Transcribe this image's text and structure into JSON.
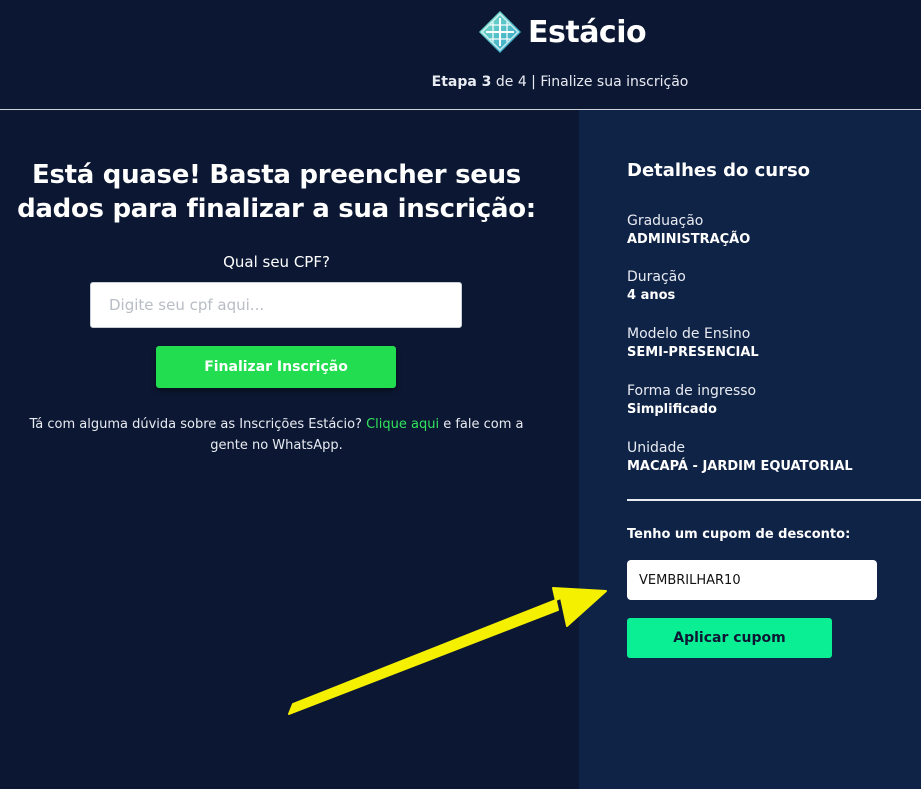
{
  "header": {
    "brand": "Estácio",
    "step_bold": "Etapa 3",
    "step_rest": " de 4 | Finalize sua inscrição"
  },
  "form": {
    "headline": "Está quase! Basta preencher seus dados para finalizar a sua inscrição:",
    "cpf_label": "Qual seu CPF?",
    "cpf_placeholder": "Digite seu cpf aqui...",
    "cpf_value": "",
    "submit_label": "Finalizar Inscrição",
    "help_before": "Tá com alguma dúvida sobre as Inscrições Estácio? ",
    "help_link": "Clique aqui",
    "help_after": " e fale com a gente no WhatsApp."
  },
  "course": {
    "title": "Detalhes do curso",
    "details": [
      {
        "label": "Graduação",
        "value": "ADMINISTRAÇÃO"
      },
      {
        "label": "Duração",
        "value": "4 anos"
      },
      {
        "label": "Modelo de Ensino",
        "value": "SEMI-PRESENCIAL"
      },
      {
        "label": "Forma de ingresso",
        "value": "Simplificado"
      },
      {
        "label": "Unidade",
        "value": "MACAPÁ - JARDIM EQUATORIAL"
      }
    ],
    "coupon_label": "Tenho um cupom de desconto:",
    "coupon_value": "VEMBRILHAR10",
    "coupon_button": "Aplicar cupom"
  },
  "colors": {
    "background": "#0c1833",
    "panel": "#0f2346",
    "green_button": "#22dd4f",
    "coupon_button": "#0bef94",
    "link": "#31e35c",
    "annotation_arrow": "#f5f000"
  },
  "icons": {
    "logo": "estacio-logo-icon",
    "annotation": "yellow-arrow-icon"
  }
}
